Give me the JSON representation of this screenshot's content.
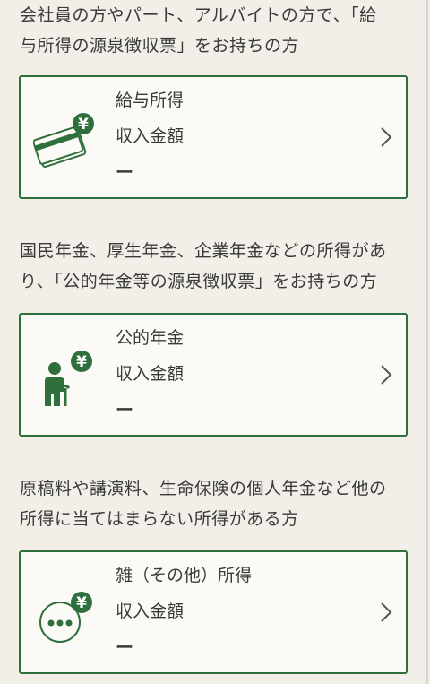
{
  "colors": {
    "background": "#f1efe8",
    "accent": "#2e6f3c",
    "card_background": "#fbfaf6",
    "text": "#3a3a3a"
  },
  "sections": [
    {
      "description": "会社員の方やパート、アルバイトの方で、「給\n与所得の源泉徴収票」をお持ちの方",
      "card": {
        "icon": "salary-card-yen-icon",
        "title": "給与所得",
        "label": "収入金額",
        "value": "ー",
        "chevron": "chevron-right-icon"
      }
    },
    {
      "description": "国民年金、厚生年金、企業年金などの所得があ\nり、「公的年金等の源泉徴収票」をお持ちの方",
      "card": {
        "icon": "pension-person-yen-icon",
        "title": "公的年金",
        "label": "収入金額",
        "value": "ー",
        "chevron": "chevron-right-icon"
      }
    },
    {
      "description": "原稿料や講演料、生命保険の個人年金など他の\n所得に当てはまらない所得がある方",
      "card": {
        "icon": "misc-dots-yen-icon",
        "title": "雑（その他）所得",
        "label": "収入金額",
        "value": "ー",
        "chevron": "chevron-right-icon"
      }
    }
  ]
}
